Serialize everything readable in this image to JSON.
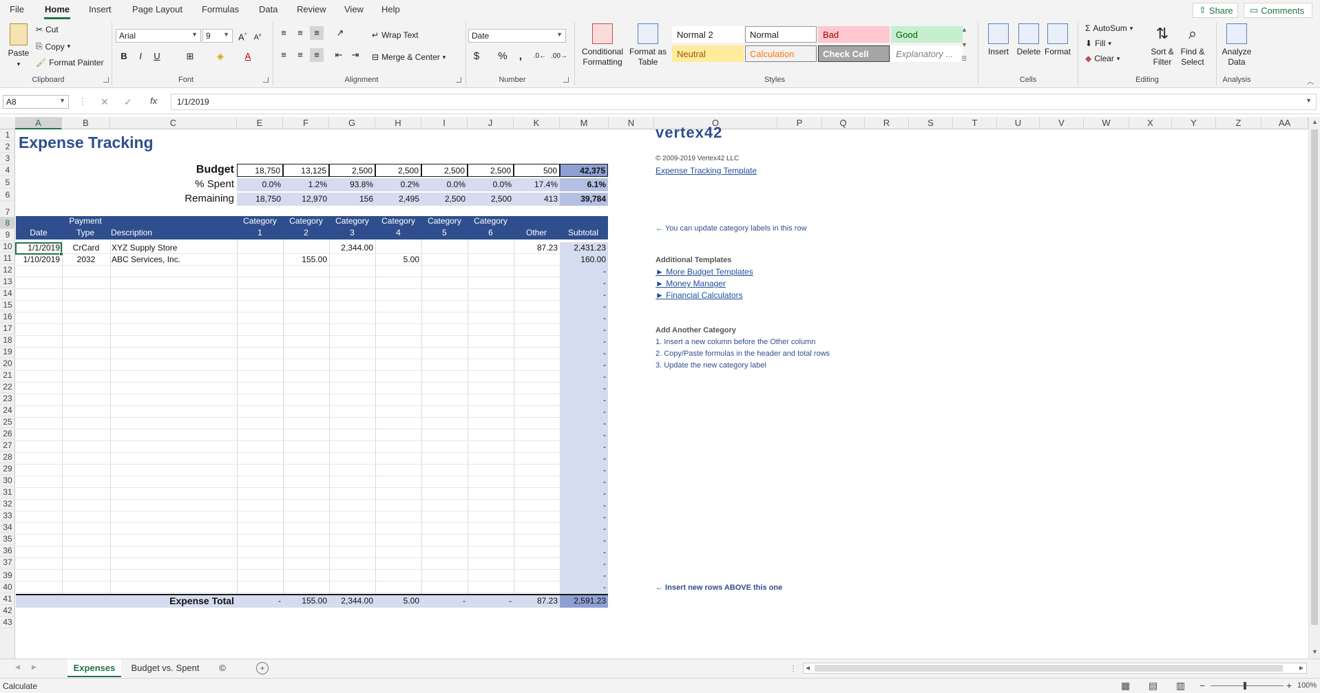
{
  "menu": {
    "tabs": [
      "File",
      "Home",
      "Insert",
      "Page Layout",
      "Formulas",
      "Data",
      "Review",
      "View",
      "Help"
    ],
    "share": "Share",
    "comments": "Comments"
  },
  "ribbon": {
    "clipboard": {
      "label": "Clipboard",
      "paste": "Paste",
      "cut": "Cut",
      "copy": "Copy",
      "format_painter": "Format Painter"
    },
    "font": {
      "label": "Font",
      "font_name": "Arial",
      "font_size": "9",
      "bold": "B",
      "italic": "I",
      "underline": "U"
    },
    "alignment": {
      "label": "Alignment",
      "wrap_text": "Wrap Text",
      "merge_center": "Merge & Center"
    },
    "number": {
      "label": "Number",
      "format": "Date",
      "currency": "$",
      "percent": "%",
      "comma": ","
    },
    "styles": {
      "label": "Styles",
      "conditional": "Conditional Formatting",
      "format_table": "Format as Table",
      "cells": [
        {
          "name": "Normal 2",
          "bg": "#ffffff",
          "fg": "#222222",
          "border": "#ffffff"
        },
        {
          "name": "Normal",
          "bg": "#ffffff",
          "fg": "#222222",
          "border": "#9a9a9a"
        },
        {
          "name": "Bad",
          "bg": "#ffc7ce",
          "fg": "#9c0006",
          "border": "#ffc7ce"
        },
        {
          "name": "Good",
          "bg": "#c6efce",
          "fg": "#006100",
          "border": "#c6efce"
        },
        {
          "name": "Neutral",
          "bg": "#ffeb9c",
          "fg": "#9c5700",
          "border": "#ffeb9c"
        },
        {
          "name": "Calculation",
          "bg": "#f2f2f2",
          "fg": "#fa7d00",
          "border": "#7f7f7f"
        },
        {
          "name": "Check Cell",
          "bg": "#a5a5a5",
          "fg": "#ffffff",
          "border": "#3f3f3f"
        },
        {
          "name": "Explanatory ...",
          "bg": "#ffffff",
          "fg": "#7f7f7f",
          "border": "#ffffff"
        }
      ]
    },
    "cells": {
      "label": "Cells",
      "insert": "Insert",
      "delete": "Delete",
      "format": "Format"
    },
    "editing": {
      "label": "Editing",
      "autosum": "AutoSum",
      "fill": "Fill",
      "clear": "Clear",
      "sort": "Sort & Filter",
      "find": "Find & Select"
    },
    "analysis": {
      "label": "Analysis",
      "analyze": "Analyze Data"
    }
  },
  "formula_bar": {
    "name_box": "A8",
    "fx": "fx",
    "value": "1/1/2019"
  },
  "columns": [
    "A",
    "B",
    "C",
    "E",
    "F",
    "G",
    "H",
    "I",
    "J",
    "K",
    "M",
    "N",
    "O",
    "P",
    "Q",
    "R",
    "S",
    "T",
    "U",
    "V",
    "W",
    "X",
    "Y",
    "Z",
    "AA"
  ],
  "rows": [
    "1",
    "2",
    "3",
    "4",
    "5",
    "6",
    "7",
    "8",
    "9",
    "10",
    "11",
    "12",
    "13",
    "14",
    "15",
    "16",
    "17",
    "18",
    "19",
    "20",
    "21",
    "22",
    "23",
    "24",
    "25",
    "26",
    "27",
    "28",
    "29",
    "30",
    "31",
    "32",
    "33",
    "34",
    "35",
    "36",
    "37",
    "39",
    "40",
    "41",
    "42",
    "43"
  ],
  "sheet": {
    "title": "Expense Tracking",
    "budget_label": "Budget",
    "spent_label": "% Spent",
    "remaining_label": "Remaining",
    "budget": [
      "18,750",
      "13,125",
      "2,500",
      "2,500",
      "2,500",
      "2,500",
      "500",
      "42,375"
    ],
    "spent": [
      "0.0%",
      "1.2%",
      "93.8%",
      "0.2%",
      "0.0%",
      "0.0%",
      "17.4%",
      "6.1%"
    ],
    "remaining": [
      "18,750",
      "12,970",
      "156",
      "2,495",
      "2,500",
      "2,500",
      "413",
      "39,784"
    ],
    "headers": {
      "date": "Date",
      "payment": "Payment",
      "type": "Type",
      "description": "Description",
      "category": "Category",
      "cat_nums": [
        "1",
        "2",
        "3",
        "4",
        "5",
        "6"
      ],
      "other": "Other",
      "subtotal": "Subtotal"
    },
    "entries": [
      {
        "date": "1/1/2019",
        "type": "CrCard",
        "desc": "XYZ Supply Store",
        "cats": [
          "",
          "",
          "2,344.00",
          "",
          "",
          ""
        ],
        "other": "87.23",
        "subtotal": "2,431.23"
      },
      {
        "date": "1/10/2019",
        "type": "2032",
        "desc": "ABC Services, Inc.",
        "cats": [
          "",
          "155.00",
          "",
          "5.00",
          "",
          ""
        ],
        "other": "",
        "subtotal": "160.00"
      }
    ],
    "dash": "-",
    "total_label": "Expense Total",
    "totals": [
      "-",
      "155.00",
      "2,344.00",
      "5.00",
      "-",
      "-",
      "87.23",
      "2,591.23"
    ],
    "logo": "vertex42",
    "copyright": "© 2009-2019 Vertex42 LLC",
    "template_link": "Expense Tracking Template",
    "note_labels": "← You can update category labels in this row",
    "additional_title": "Additional Templates",
    "links": [
      "► More Budget Templates",
      "► Money Manager",
      "► Financial Calculators"
    ],
    "add_title": "Add Another Category",
    "steps": [
      "1. Insert a new column before the Other column",
      "2. Copy/Paste formulas in the header and total rows",
      "3. Update the new category label"
    ],
    "insert_note": "← Insert new rows ABOVE this one"
  },
  "tabs": [
    "Expenses",
    "Budget vs. Spent",
    "©"
  ],
  "status": {
    "mode": "Calculate",
    "zoom": "100%"
  },
  "colors": {
    "header_blue": "#2f4e8e",
    "light_blue": "#d6dcef",
    "subtotal_blue": "#b4c0e2",
    "accent": "#217346"
  }
}
